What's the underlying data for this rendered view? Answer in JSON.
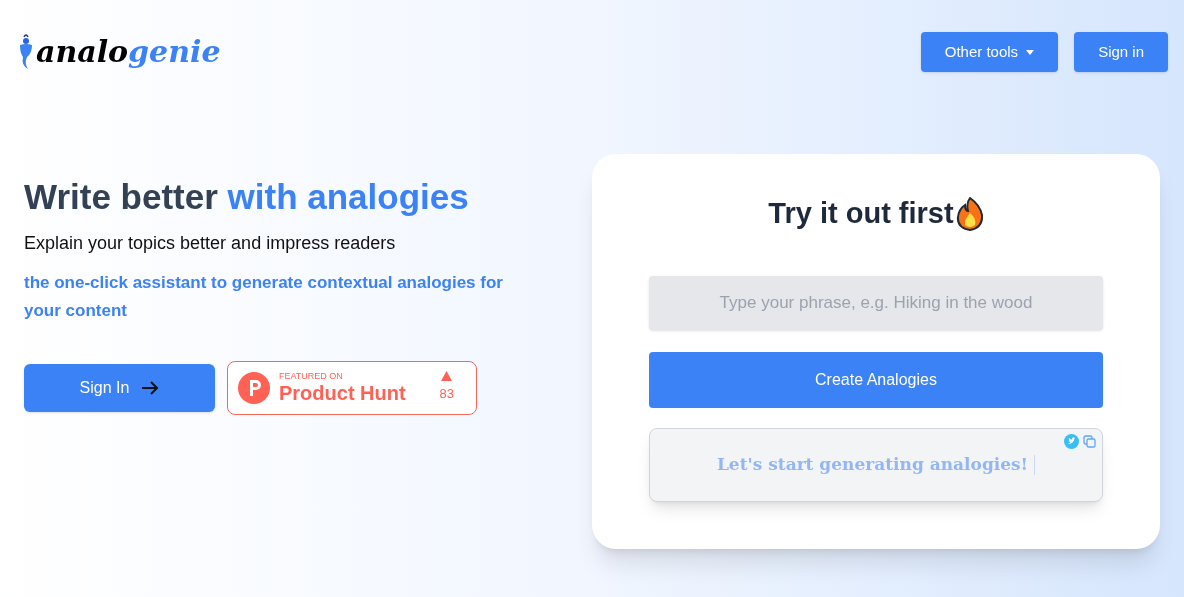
{
  "header": {
    "logo": {
      "part_1": "analo",
      "part_2": "genie"
    },
    "buttons": [
      {
        "label": "Other tools",
        "kind": "dropdown"
      },
      {
        "label": "Sign in",
        "kind": "plain"
      }
    ]
  },
  "hero": {
    "headline": {
      "plain": "Write better ",
      "highlight": "with analogies"
    },
    "subtitle": "Explain your topics better and impress readers",
    "tagline": "the one-click assistant to generate contextual analogies for your content",
    "sign_in_button": "Sign In",
    "product_hunt": {
      "caption": "FEATURED ON",
      "name": "Product Hunt",
      "votes": "83"
    }
  },
  "try_card": {
    "title": "Try it out first",
    "input": {
      "placeholder": "Type your phrase, e.g. Hiking in the wood"
    },
    "button": "Create Analogies",
    "output": "Let's start generating analogies!"
  }
}
